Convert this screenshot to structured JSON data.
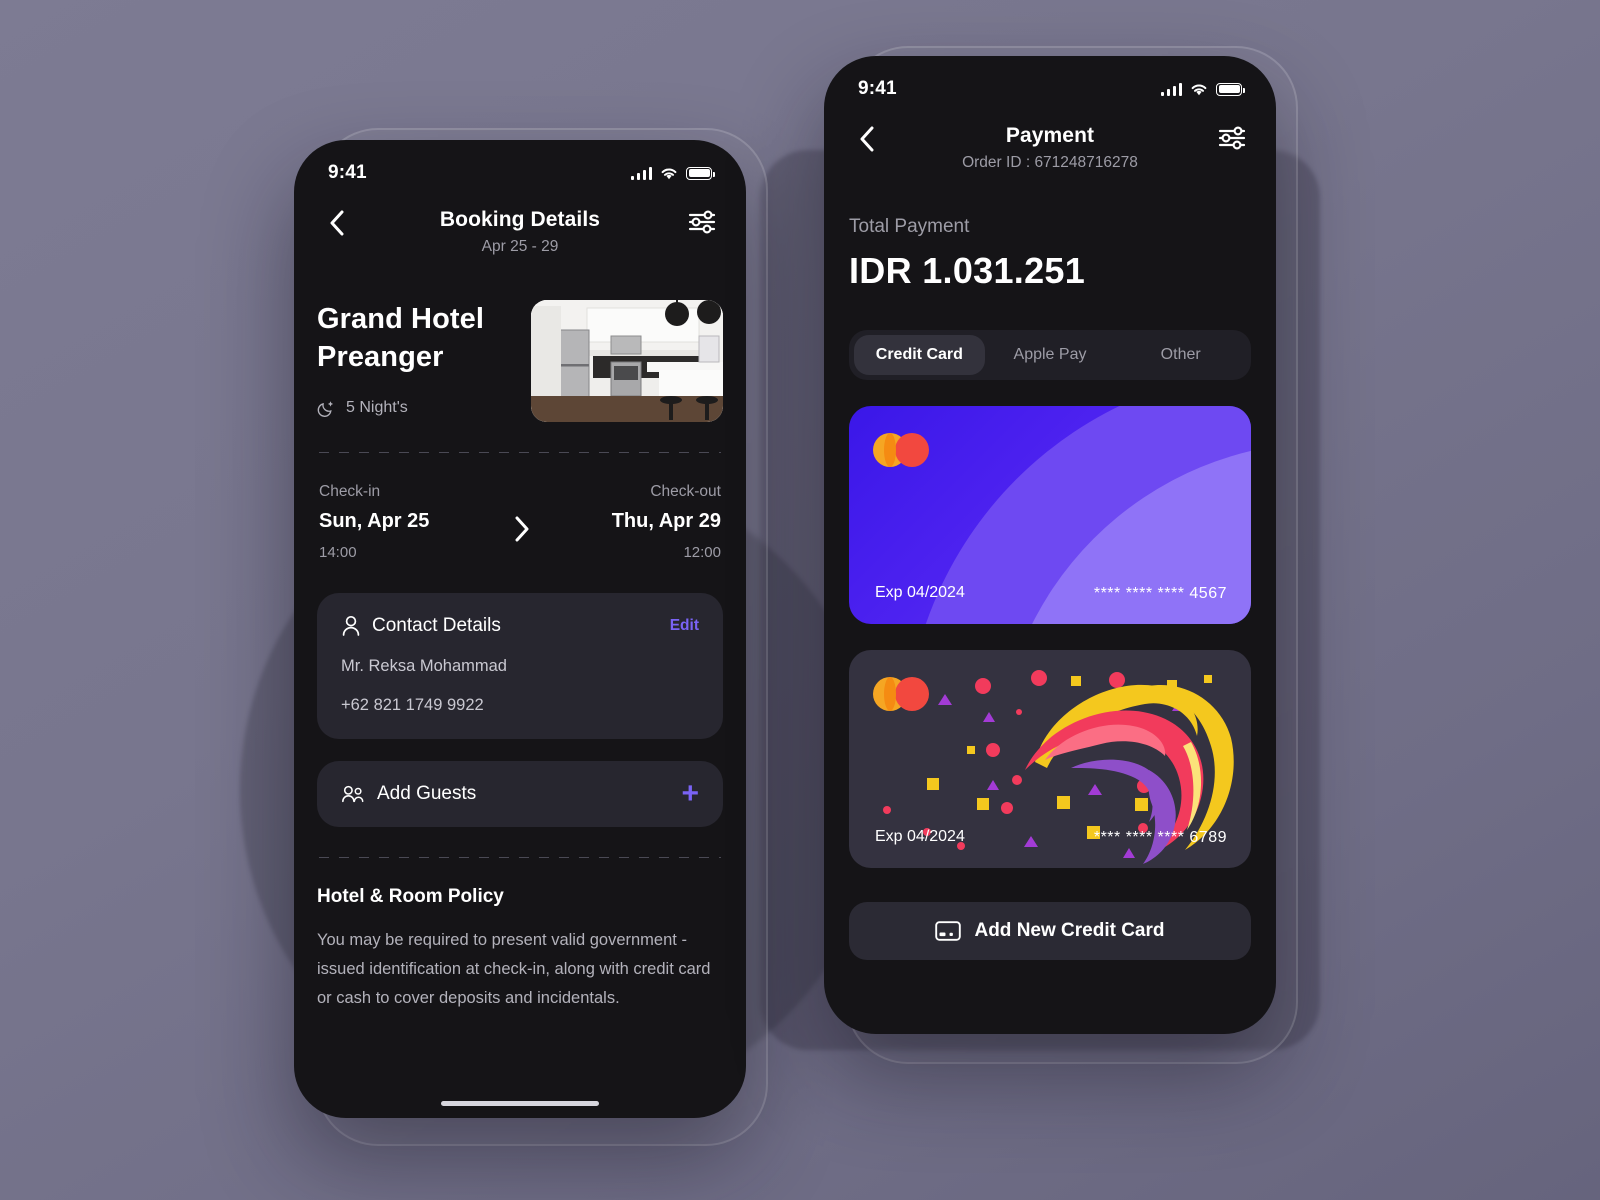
{
  "background": {
    "color": "#78768e"
  },
  "accent": {
    "purple": "#7a63f5",
    "card_purple": "#5b2cf0"
  },
  "booking_screen": {
    "statusbar": {
      "time": "9:41"
    },
    "nav": {
      "title": "Booking Details",
      "subtitle": "Apr 25 - 29",
      "back_icon": "chevron-left-icon",
      "filter_icon": "sliders-icon"
    },
    "hotel": {
      "name": "Grand Hotel Preanger",
      "nights": "5 Night's",
      "nights_icon": "moon-stars-icon",
      "thumbnail_alt": "hotel-room-photo"
    },
    "dates": {
      "checkin_label": "Check-in",
      "checkin_date": "Sun, Apr 25",
      "checkin_time": "14:00",
      "checkout_label": "Check-out",
      "checkout_date": "Thu, Apr 29",
      "checkout_time": "12:00",
      "arrow_icon": "chevron-right-icon"
    },
    "contact": {
      "title": "Contact Details",
      "icon": "person-icon",
      "edit_label": "Edit",
      "name": "Mr. Reksa Mohammad",
      "phone": "+62 821 1749 9922"
    },
    "add_guests": {
      "label": "Add Guests",
      "icon": "people-icon",
      "plus_label": "+"
    },
    "policy": {
      "title": "Hotel & Room Policy",
      "text": "You may be required to present valid government - issued identification at check-in, along with credit card or cash to cover deposits and incidentals."
    }
  },
  "payment_screen": {
    "statusbar": {
      "time": "9:41"
    },
    "nav": {
      "title": "Payment",
      "subtitle": "Order ID : 671248716278",
      "back_icon": "chevron-left-icon",
      "filter_icon": "sliders-icon"
    },
    "total": {
      "label": "Total Payment",
      "amount": "IDR 1.031.251"
    },
    "tabs": [
      {
        "label": "Credit Card",
        "active": true
      },
      {
        "label": "Apple Pay",
        "active": false
      },
      {
        "label": "Other",
        "active": false
      }
    ],
    "cards": [
      {
        "brand_icon": "mastercard-icon",
        "exp": "Exp 04/2024",
        "number": "**** **** **** 4567",
        "style": "purple-gradient"
      },
      {
        "brand_icon": "mastercard-icon",
        "exp": "Exp 04/2024",
        "number": "**** **** **** 6789",
        "style": "dark-paint-splash"
      }
    ],
    "add_card": {
      "label": "Add New Credit Card",
      "icon": "credit-card-icon"
    }
  }
}
